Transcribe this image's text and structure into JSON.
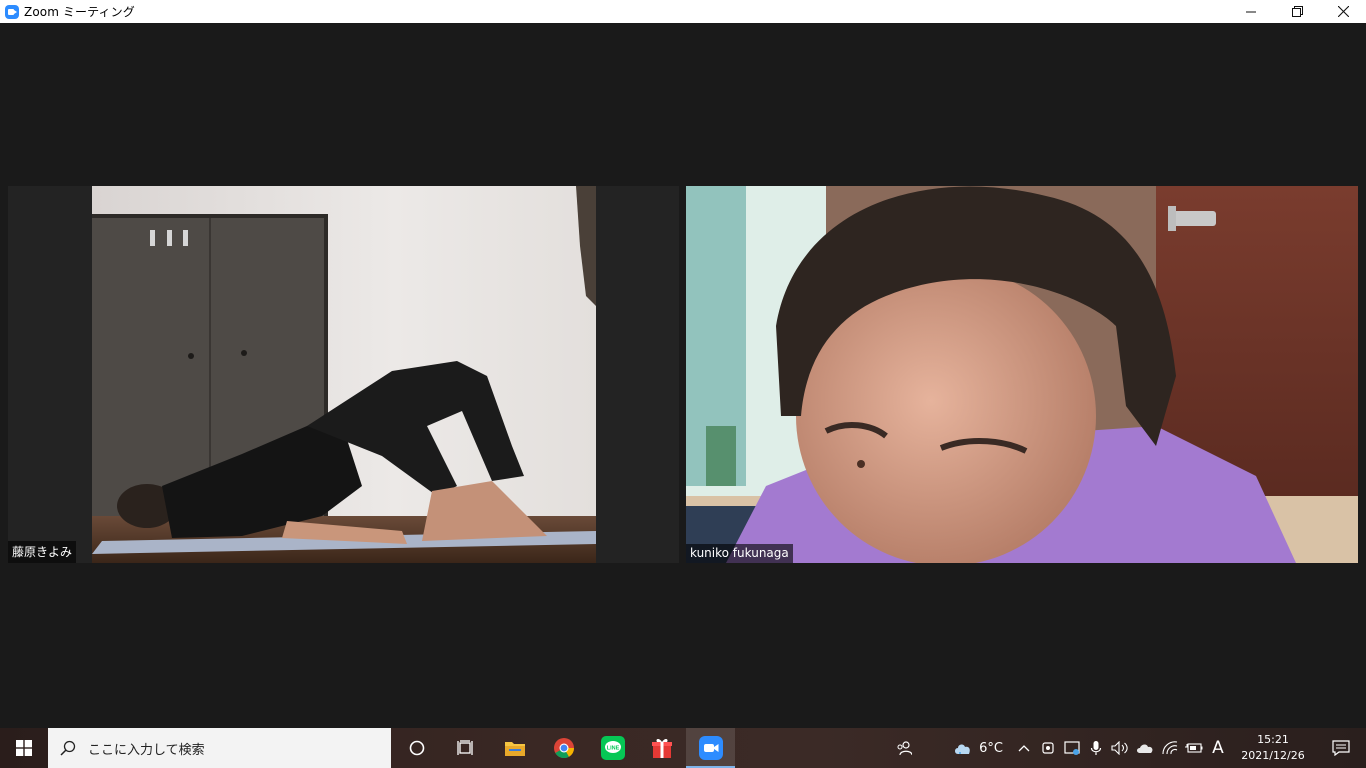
{
  "window": {
    "title": "Zoom ミーティング",
    "minimize_glyph": "—",
    "restore_glyph": "❐",
    "close_glyph": "✕"
  },
  "participants": [
    {
      "name": "藤原きよみ"
    },
    {
      "name": "kuniko fukunaga"
    }
  ],
  "taskbar": {
    "search_placeholder": "ここに入力して検索",
    "pinned": [
      {
        "icon": "cortana-icon"
      },
      {
        "icon": "task-view-icon"
      },
      {
        "icon": "file-explorer-icon"
      },
      {
        "icon": "chrome-icon"
      },
      {
        "icon": "line-icon"
      },
      {
        "icon": "gift-icon"
      },
      {
        "icon": "zoom-icon"
      }
    ],
    "tray": {
      "weather_temp": "6°C",
      "ime_mode": "A",
      "time": "15:21",
      "date": "2021/12/26"
    }
  },
  "colors": {
    "zoom_blue": "#2d8cff",
    "video_bg": "#1a1a1a",
    "taskbar_accent": "#7eb4ea"
  }
}
